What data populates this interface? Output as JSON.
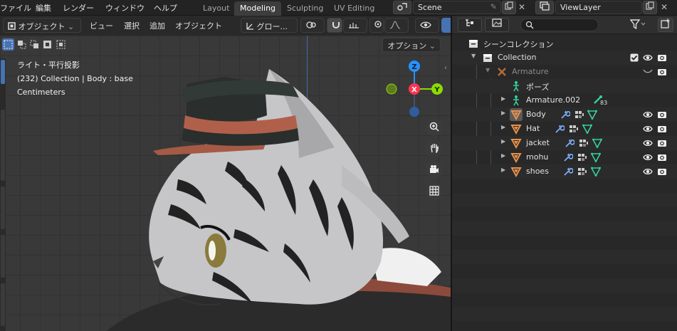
{
  "menubar": {
    "items": [
      "ファイル",
      "編集",
      "レンダー",
      "ウィンドウ",
      "ヘルプ"
    ]
  },
  "workspaces": {
    "tabs": [
      "Layout",
      "Modeling",
      "Sculpting",
      "UV Editing"
    ],
    "active": "Modeling"
  },
  "scene": {
    "name": "Scene"
  },
  "view_layer": {
    "name": "ViewLayer"
  },
  "viewport": {
    "mode": "オブジェクト",
    "menus": [
      "ビュー",
      "選択",
      "追加",
      "オブジェクト"
    ],
    "orientation": "グロー...",
    "options_label": "オプション",
    "overlay_lines": [
      "ライト・平行投影",
      "(232) Collection | Body : base",
      "Centimeters"
    ],
    "gizmo_axes": {
      "z": "Z",
      "x": "X",
      "y": "Y"
    },
    "axis_colors": {
      "x": "#ff3352",
      "y": "#8bdc00",
      "z": "#2890ff"
    }
  },
  "outliner": {
    "search_placeholder": "",
    "scene_collection": "シーンコレクション",
    "collection": "Collection",
    "armature": "Armature",
    "pose": "ポーズ",
    "armature_child": "Armature.002",
    "bone_count": "83",
    "meshes": [
      "Body",
      "Hat",
      "jacket",
      "mohu",
      "shoes"
    ]
  },
  "colors": {
    "accent": "#4772b3",
    "mesh_icon": "#e8914a",
    "modifier_icon": "#7eb0ff",
    "mesh_data_icon": "#35d09a"
  }
}
